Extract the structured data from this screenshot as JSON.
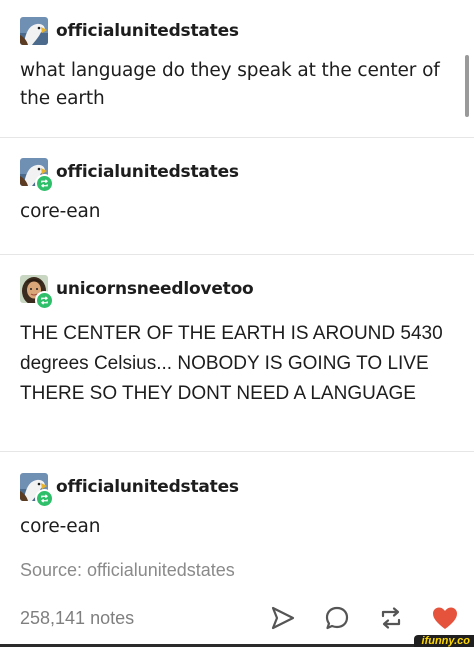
{
  "thread": [
    {
      "username": "officialunitedstates",
      "avatar": "eagle-avatar",
      "reblog": false,
      "text": "what language do they speak at the center of the earth"
    },
    {
      "username": "officialunitedstates",
      "avatar": "eagle-avatar",
      "reblog": true,
      "text": "core-ean"
    },
    {
      "username": "unicornsneedlovetoo",
      "avatar": "person-avatar",
      "reblog": true,
      "text": "THE CENTER OF THE EARTH IS AROUND 5430 degrees Celsius... NOBODY IS GOING TO LIVE THERE SO THEY DONT NEED A LANGUAGE"
    },
    {
      "username": "officialunitedstates",
      "avatar": "eagle-avatar",
      "reblog": true,
      "text": "core-ean"
    }
  ],
  "source_label": "Source: officialunitedstates",
  "footer": {
    "notes": "258,141 notes",
    "actions": [
      "share-icon",
      "reply-icon",
      "reblog-icon",
      "like-icon"
    ]
  },
  "watermark": "ifunny.co",
  "colors": {
    "reblog_badge": "#2fbf6a",
    "like": "#e5533d",
    "muted_text": "#8a8a8a",
    "icon_gray": "#555555"
  }
}
